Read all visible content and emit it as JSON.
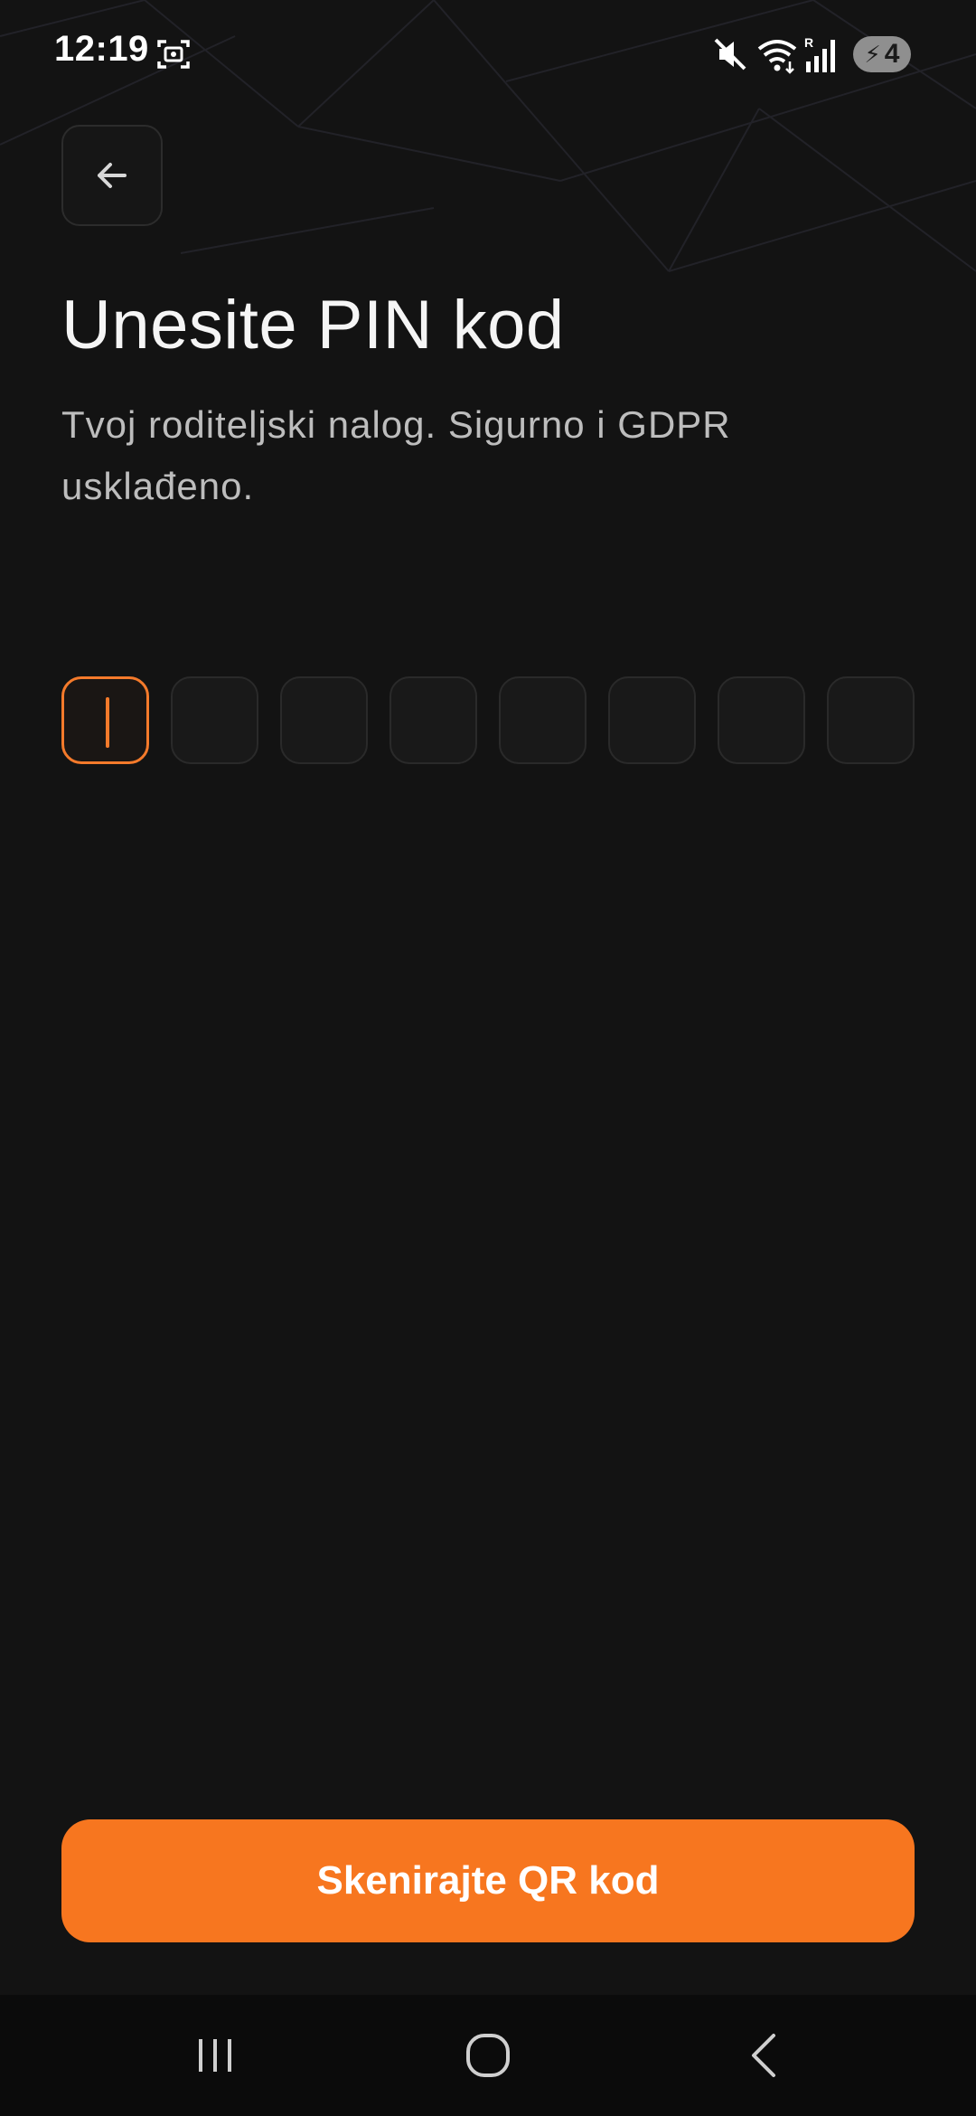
{
  "status_bar": {
    "time": "12:19",
    "battery_level": "4",
    "icons": [
      "screenshot-icon",
      "mute-icon",
      "wifi-icon",
      "signal-icon",
      "battery-charging-icon"
    ]
  },
  "header": {
    "back_icon": "arrow-left-icon"
  },
  "main": {
    "title": "Unesite PIN kod",
    "subtitle": "Tvoj roditeljski nalog. Sigurno i GDPR usklađeno.",
    "pin": {
      "length": 8,
      "values": [
        "",
        "",
        "",
        "",
        "",
        "",
        "",
        ""
      ],
      "active_index": 0
    },
    "primary_button_label": "Skenirajte QR kod"
  },
  "nav_bar": {
    "icons": [
      "recents-icon",
      "home-icon",
      "back-nav-icon"
    ]
  },
  "colors": {
    "background": "#131313",
    "accent": "#f7761f",
    "text_primary": "#f5f5f5",
    "text_secondary": "#bdbdbd"
  }
}
